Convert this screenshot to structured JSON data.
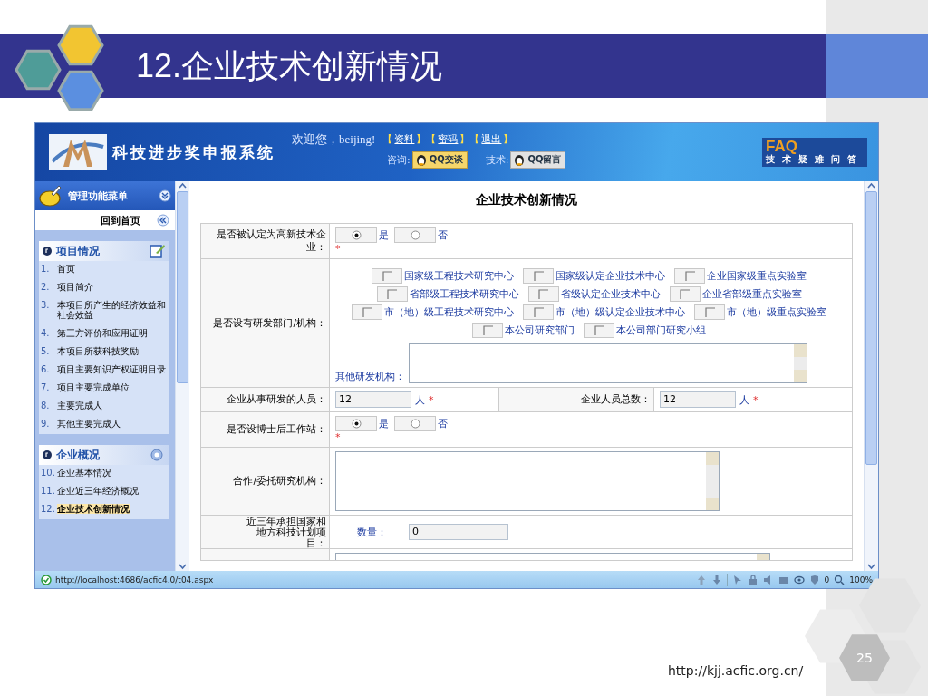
{
  "slide": {
    "title": "12.企业技术创新情况",
    "footer_url": "http://kjj.acfic.org.cn/",
    "page_number": "25"
  },
  "header": {
    "system_name": "科技进步奖申报系统",
    "welcome": "欢迎您，beijing!",
    "links": [
      {
        "open": "【",
        "label": "资料",
        "close": "】"
      },
      {
        "open": "【",
        "label": "密码",
        "close": "】"
      },
      {
        "open": "【",
        "label": "退出",
        "close": "】"
      }
    ],
    "consult_label": "咨询:",
    "qq_chat": "QQ交谈",
    "tech_label": "技术:",
    "qq_message": "QQ留言",
    "faq_title": "FAQ",
    "faq_subtitle": "技术疑难问答"
  },
  "sidebar": {
    "menu_title": "管理功能菜单",
    "home": "回到首页",
    "sections": [
      {
        "title": "项目情况",
        "items": [
          {
            "number": "1.",
            "label": "首页",
            "selected": false
          },
          {
            "number": "2.",
            "label": "项目简介",
            "selected": false
          },
          {
            "number": "3.",
            "label": "本项目所产生的经济效益和社会效益",
            "selected": false
          },
          {
            "number": "4.",
            "label": "第三方评价和应用证明",
            "selected": false
          },
          {
            "number": "5.",
            "label": "本项目所获科技奖励",
            "selected": false
          },
          {
            "number": "6.",
            "label": "项目主要知识产权证明目录",
            "selected": false
          },
          {
            "number": "7.",
            "label": "项目主要完成单位",
            "selected": false
          },
          {
            "number": "8.",
            "label": "主要完成人",
            "selected": false
          },
          {
            "number": "9.",
            "label": "其他主要完成人",
            "selected": false
          }
        ]
      },
      {
        "title": "企业概况",
        "items": [
          {
            "number": "10.",
            "label": "企业基本情况",
            "selected": false
          },
          {
            "number": "11.",
            "label": "企业近三年经济概况",
            "selected": false
          },
          {
            "number": "12.",
            "label": "企业技术创新情况",
            "selected": true
          }
        ]
      }
    ]
  },
  "form": {
    "title": "企业技术创新情况",
    "rows": [
      {
        "kind": "radio",
        "label": "是否被认定为高新技术企业：",
        "options": [
          {
            "label": "是",
            "selected": true
          },
          {
            "label": "否",
            "selected": false
          }
        ],
        "required": "*"
      },
      {
        "kind": "checkboxes",
        "label": "是否设有研发部门/机构：",
        "lines": [
          [
            {
              "label": "国家级工程技术研究中心",
              "checked": false
            },
            {
              "label": "国家级认定企业技术中心",
              "checked": false
            },
            {
              "label": "企业国家级重点实验室",
              "checked": false
            }
          ],
          [
            {
              "label": "省部级工程技术研究中心",
              "checked": false
            },
            {
              "label": "省级认定企业技术中心",
              "checked": false
            },
            {
              "label": "企业省部级重点实验室",
              "checked": false
            }
          ],
          [
            {
              "label": "市（地）级工程技术研究中心",
              "checked": false
            },
            {
              "label": "市（地）级认定企业技术中心",
              "checked": false
            },
            {
              "label": "市（地）级重点实验室",
              "checked": false
            }
          ],
          [
            {
              "label": "本公司研究部门",
              "checked": false
            },
            {
              "label": "本公司部门研究小组",
              "checked": false
            }
          ]
        ],
        "other_label": "其他研发机构："
      },
      {
        "kind": "pair",
        "fields": [
          {
            "label": "企业从事研发的人员：",
            "value": "12",
            "unit": "人",
            "required": "*"
          },
          {
            "label": "企业人员总数：",
            "value": "12",
            "unit": "人",
            "required": "*"
          }
        ]
      },
      {
        "kind": "radio",
        "label": "是否设博士后工作站：",
        "options": [
          {
            "label": "是",
            "selected": true
          },
          {
            "label": "否",
            "selected": false
          }
        ],
        "required": "*"
      },
      {
        "kind": "textarea",
        "label": "合作/委托研究机构："
      },
      {
        "kind": "count",
        "label": "近三年承担国家和地方科技计划项目：",
        "field_label": "数量：",
        "value": "0"
      },
      {
        "kind": "textarea"
      }
    ]
  },
  "status_bar": {
    "url": "http://localhost:4686/acfic4.0/t04.aspx",
    "blocked_count": "0",
    "zoom": "100%"
  }
}
